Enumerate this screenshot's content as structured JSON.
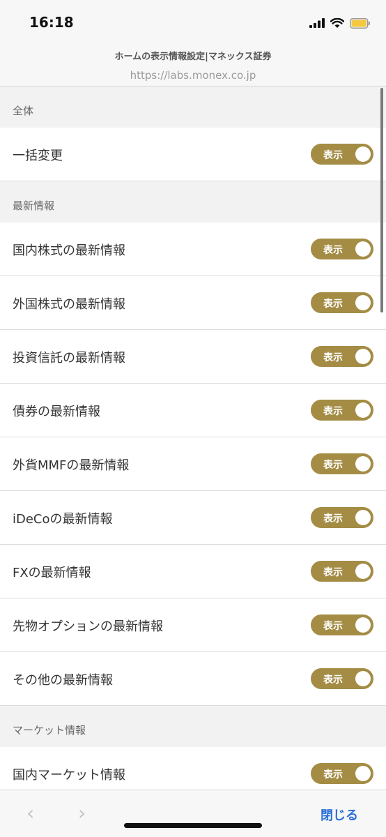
{
  "status": {
    "time": "16:18",
    "icons": [
      "signal-bars-icon",
      "wifi-icon",
      "battery-icon"
    ],
    "battery_color": "#f5c842"
  },
  "header": {
    "title": "ホームの表示情報設定|マネックス証券",
    "url": "https://labs.monex.co.jp"
  },
  "toggle_color": "#a48c45",
  "sections": [
    {
      "title": "全体",
      "items": [
        {
          "label": "一括変更",
          "toggle": "表示",
          "on": true
        }
      ]
    },
    {
      "title": "最新情報",
      "items": [
        {
          "label": "国内株式の最新情報",
          "toggle": "表示",
          "on": true
        },
        {
          "label": "外国株式の最新情報",
          "toggle": "表示",
          "on": true
        },
        {
          "label": "投資信託の最新情報",
          "toggle": "表示",
          "on": true
        },
        {
          "label": "債券の最新情報",
          "toggle": "表示",
          "on": true
        },
        {
          "label": "外貨MMFの最新情報",
          "toggle": "表示",
          "on": true
        },
        {
          "label": "iDeCoの最新情報",
          "toggle": "表示",
          "on": true
        },
        {
          "label": "FXの最新情報",
          "toggle": "表示",
          "on": true
        },
        {
          "label": "先物オプションの最新情報",
          "toggle": "表示",
          "on": true
        },
        {
          "label": "その他の最新情報",
          "toggle": "表示",
          "on": true
        }
      ]
    },
    {
      "title": "マーケット情報",
      "items": [
        {
          "label": "国内マーケット情報",
          "toggle": "表示",
          "on": true
        }
      ]
    }
  ],
  "bottom_bar": {
    "back_icon": "‹",
    "forward_icon": "›",
    "close_label": "閉じる",
    "close_color": "#2b6fd6"
  }
}
